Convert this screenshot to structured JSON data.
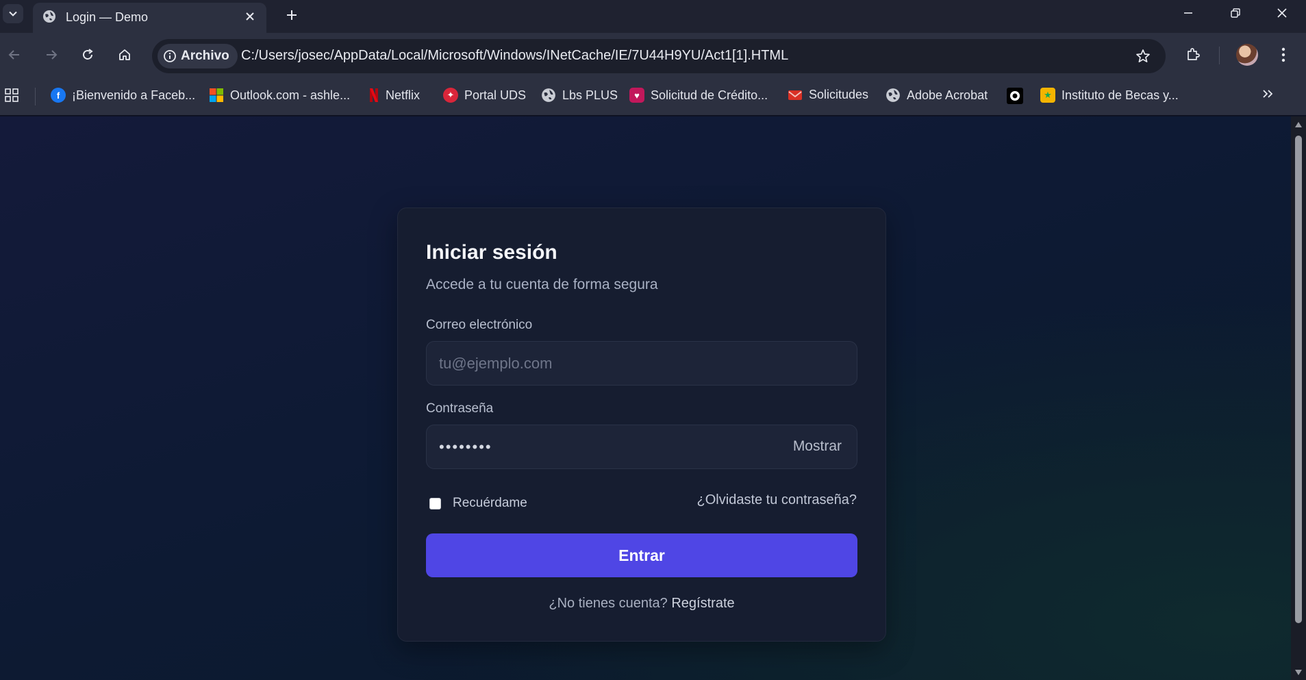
{
  "browser": {
    "tab": {
      "title": "Login — Demo"
    },
    "address": {
      "chip_label": "Archivo",
      "url": "C:/Users/josec/AppData/Local/Microsoft/Windows/INetCache/IE/7U44H9YU/Act1[1].HTML"
    },
    "bookmarks": [
      {
        "label": "¡Bienvenido a Faceb...",
        "icon": "facebook-icon",
        "color": "#1877f2"
      },
      {
        "label": "Outlook.com - ashle...",
        "icon": "microsoft-icon",
        "color": "#f25022"
      },
      {
        "label": "Netflix",
        "icon": "netflix-icon",
        "color": "#e50914"
      },
      {
        "label": "Portal UDS",
        "icon": "portal-uds-icon",
        "color": "#d9263a"
      },
      {
        "label": "Lbs PLUS",
        "icon": "globe-icon",
        "color": "#c9ccd4"
      },
      {
        "label": "Solicitud de Crédito...",
        "icon": "credit-icon",
        "color": "#c2185b"
      },
      {
        "label": "Solicitudes",
        "icon": "gmail-icon",
        "color": "#d93025"
      },
      {
        "label": "Adobe Acrobat",
        "icon": "globe-icon",
        "color": "#c9ccd4"
      },
      {
        "label": "",
        "icon": "circle-app-icon",
        "color": "#ffffff"
      },
      {
        "label": "Instituto de Becas y...",
        "icon": "becas-icon",
        "color": "#f4b400"
      }
    ]
  },
  "login": {
    "title": "Iniciar sesión",
    "subtitle": "Accede a tu cuenta de forma segura",
    "email_label": "Correo electrónico",
    "email_placeholder": "tu@ejemplo.com",
    "password_label": "Contraseña",
    "password_value": "••••••••",
    "show_label": "Mostrar",
    "remember_label": "Recuérdame",
    "remember_checked": false,
    "forgot_label": "¿Olvidaste tu contraseña?",
    "submit_label": "Entrar",
    "signup_prompt": "¿No tienes cuenta?",
    "signup_link": "Regístrate"
  },
  "colors": {
    "accent": "#4f46e5",
    "card_bg": "#161d30",
    "page_bg": "#0e1222"
  }
}
